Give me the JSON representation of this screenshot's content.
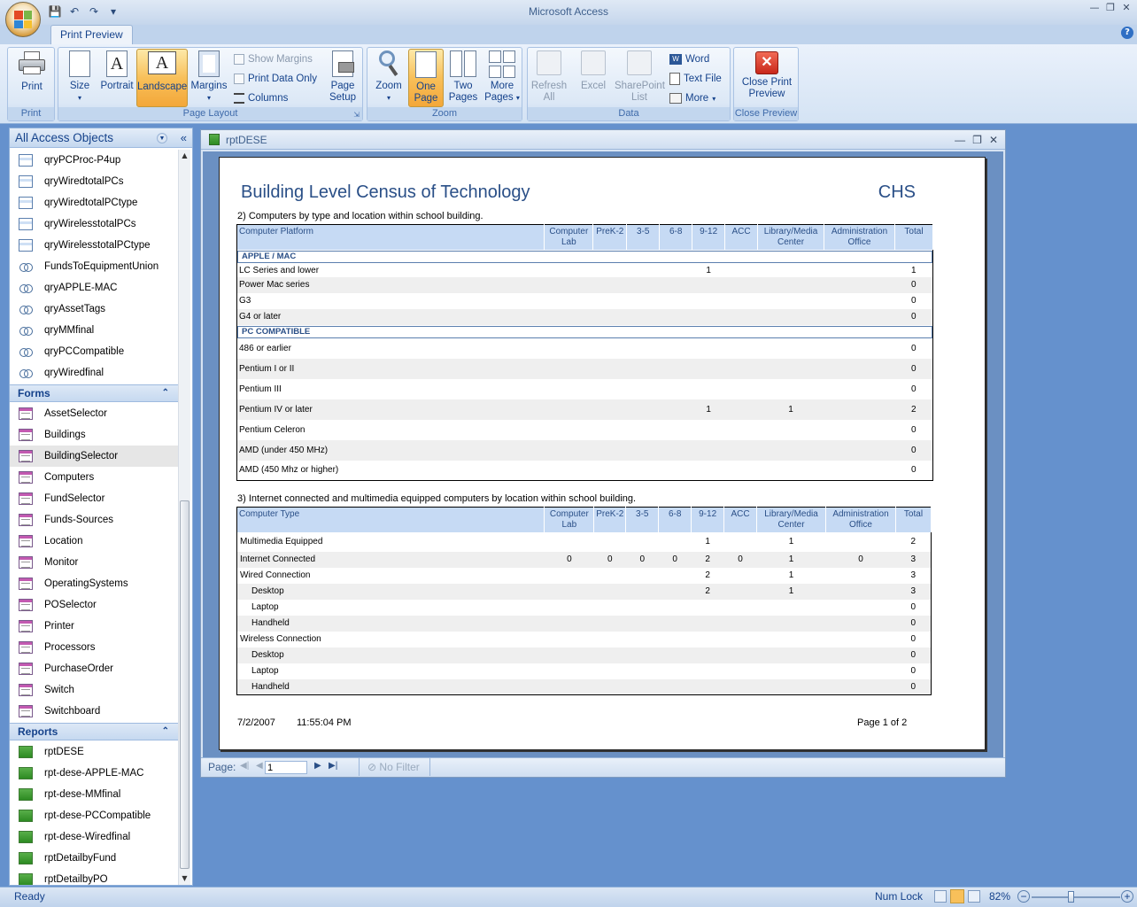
{
  "app": {
    "title": "Microsoft Access"
  },
  "ribbon": {
    "tab": "Print Preview",
    "groups": {
      "print": "Print",
      "page_layout": "Page Layout",
      "zoom": "Zoom",
      "data": "Data",
      "close_preview": "Close Preview"
    },
    "buttons": {
      "print": "Print",
      "size": "Size",
      "portrait": "Portrait",
      "landscape": "Landscape",
      "margins": "Margins",
      "show_margins": "Show Margins",
      "print_data_only": "Print Data Only",
      "columns": "Columns",
      "page_setup_1": "Page",
      "page_setup_2": "Setup",
      "zoom": "Zoom",
      "one_page_1": "One",
      "one_page_2": "Page",
      "two_pages_1": "Two",
      "two_pages_2": "Pages",
      "more_pages_1": "More",
      "more_pages_2": "Pages",
      "refresh_1": "Refresh",
      "refresh_2": "All",
      "excel": "Excel",
      "sharepoint_1": "SharePoint",
      "sharepoint_2": "List",
      "word": "Word",
      "text_file": "Text File",
      "more": "More",
      "close_print_preview_1": "Close Print",
      "close_print_preview_2": "Preview"
    }
  },
  "nav": {
    "header": "All Access Objects",
    "queries": [
      {
        "label": "qryPCProc-P4up",
        "icon": "query"
      },
      {
        "label": "qryWiredtotalPCs",
        "icon": "query"
      },
      {
        "label": "qryWiredtotalPCtype",
        "icon": "query"
      },
      {
        "label": "qryWirelesstotalPCs",
        "icon": "query"
      },
      {
        "label": "qryWirelesstotalPCtype",
        "icon": "query"
      },
      {
        "label": "FundsToEquipmentUnion",
        "icon": "union"
      },
      {
        "label": "qryAPPLE-MAC",
        "icon": "union"
      },
      {
        "label": "qryAssetTags",
        "icon": "union"
      },
      {
        "label": "qryMMfinal",
        "icon": "union"
      },
      {
        "label": "qryPCCompatible",
        "icon": "union"
      },
      {
        "label": "qryWiredfinal",
        "icon": "union"
      }
    ],
    "forms_header": "Forms",
    "forms": [
      "AssetSelector",
      "Buildings",
      "BuildingSelector",
      "Computers",
      "FundSelector",
      "Funds-Sources",
      "Location",
      "Monitor",
      "OperatingSystems",
      "POSelector",
      "Printer",
      "Processors",
      "PurchaseOrder",
      "Switch",
      "Switchboard"
    ],
    "selected_form": "BuildingSelector",
    "reports_header": "Reports",
    "reports": [
      "rptDESE",
      "rpt-dese-APPLE-MAC",
      "rpt-dese-MMfinal",
      "rpt-dese-PCCompatible",
      "rpt-dese-Wiredfinal",
      "rptDetailbyFund",
      "rptDetailbyPO"
    ]
  },
  "report_window": {
    "title": "rptDESE",
    "page_label": "Page:",
    "page_value": "1",
    "no_filter": "No Filter"
  },
  "report": {
    "title": "Building Level Census of Technology",
    "school": "CHS",
    "section2_title": "2) Computers by type and location within school building.",
    "section2_columns": [
      "Computer Platform",
      "Computer Lab",
      "PreK-2",
      "3-5",
      "6-8",
      "9-12",
      "ACC",
      "Library/Media Center",
      "Administration Office",
      "Total"
    ],
    "section2_groups": [
      {
        "name": "APPLE / MAC",
        "rows": [
          {
            "label": "LC Series and lower",
            "values": [
              "",
              "",
              "",
              "",
              "1",
              "",
              "",
              "",
              "1"
            ]
          },
          {
            "label": "Power Mac series",
            "values": [
              "",
              "",
              "",
              "",
              "",
              "",
              "",
              "",
              "0"
            ]
          },
          {
            "label": "G3",
            "values": [
              "",
              "",
              "",
              "",
              "",
              "",
              "",
              "",
              "0"
            ]
          },
          {
            "label": "G4 or later",
            "values": [
              "",
              "",
              "",
              "",
              "",
              "",
              "",
              "",
              "0"
            ]
          }
        ]
      },
      {
        "name": "PC COMPATIBLE",
        "rows": [
          {
            "label": "486 or earlier",
            "values": [
              "",
              "",
              "",
              "",
              "",
              "",
              "",
              "",
              "0"
            ]
          },
          {
            "label": "Pentium I or II",
            "values": [
              "",
              "",
              "",
              "",
              "",
              "",
              "",
              "",
              "0"
            ]
          },
          {
            "label": "Pentium III",
            "values": [
              "",
              "",
              "",
              "",
              "",
              "",
              "",
              "",
              "0"
            ]
          },
          {
            "label": "Pentium IV or later",
            "values": [
              "",
              "",
              "",
              "",
              "1",
              "",
              "1",
              "",
              "2"
            ]
          },
          {
            "label": "Pentium Celeron",
            "values": [
              "",
              "",
              "",
              "",
              "",
              "",
              "",
              "",
              "0"
            ]
          },
          {
            "label": "AMD (under 450 MHz)",
            "values": [
              "",
              "",
              "",
              "",
              "",
              "",
              "",
              "",
              "0"
            ]
          },
          {
            "label": "AMD (450 Mhz or higher)",
            "values": [
              "",
              "",
              "",
              "",
              "",
              "",
              "",
              "",
              "0"
            ]
          }
        ]
      }
    ],
    "section3_title": "3) Internet connected and multimedia equipped computers by location within school building.",
    "section3_columns": [
      "Computer Type",
      "Computer Lab",
      "PreK-2",
      "3-5",
      "6-8",
      "9-12",
      "ACC",
      "Library/Media Center",
      "Administration Office",
      "Total"
    ],
    "section3_rows": [
      {
        "label": "Multimedia Equipped",
        "indent": false,
        "values": [
          "",
          "",
          "",
          "",
          "1",
          "",
          "1",
          "",
          "2"
        ]
      },
      {
        "label": "Internet Connected",
        "indent": false,
        "values": [
          "0",
          "0",
          "0",
          "0",
          "2",
          "0",
          "1",
          "0",
          "3"
        ]
      },
      {
        "label": "Wired Connection",
        "indent": false,
        "values": [
          "",
          "",
          "",
          "",
          "2",
          "",
          "1",
          "",
          "3"
        ]
      },
      {
        "label": "Desktop",
        "indent": true,
        "values": [
          "",
          "",
          "",
          "",
          "2",
          "",
          "1",
          "",
          "3"
        ]
      },
      {
        "label": "Laptop",
        "indent": true,
        "values": [
          "",
          "",
          "",
          "",
          "",
          "",
          "",
          "",
          "0"
        ]
      },
      {
        "label": "Handheld",
        "indent": true,
        "values": [
          "",
          "",
          "",
          "",
          "",
          "",
          "",
          "",
          "0"
        ]
      },
      {
        "label": "Wireless Connection",
        "indent": false,
        "values": [
          "",
          "",
          "",
          "",
          "",
          "",
          "",
          "",
          "0"
        ]
      },
      {
        "label": "Desktop",
        "indent": true,
        "values": [
          "",
          "",
          "",
          "",
          "",
          "",
          "",
          "",
          "0"
        ]
      },
      {
        "label": "Laptop",
        "indent": true,
        "values": [
          "",
          "",
          "",
          "",
          "",
          "",
          "",
          "",
          "0"
        ]
      },
      {
        "label": "Handheld",
        "indent": true,
        "values": [
          "",
          "",
          "",
          "",
          "",
          "",
          "",
          "",
          "0"
        ]
      }
    ],
    "footer_date": "7/2/2007",
    "footer_time": "11:55:04 PM",
    "footer_page": "Page 1 of 2"
  },
  "status": {
    "ready": "Ready",
    "num_lock": "Num Lock",
    "zoom": "82%",
    "zoom_level_percent": 82
  }
}
